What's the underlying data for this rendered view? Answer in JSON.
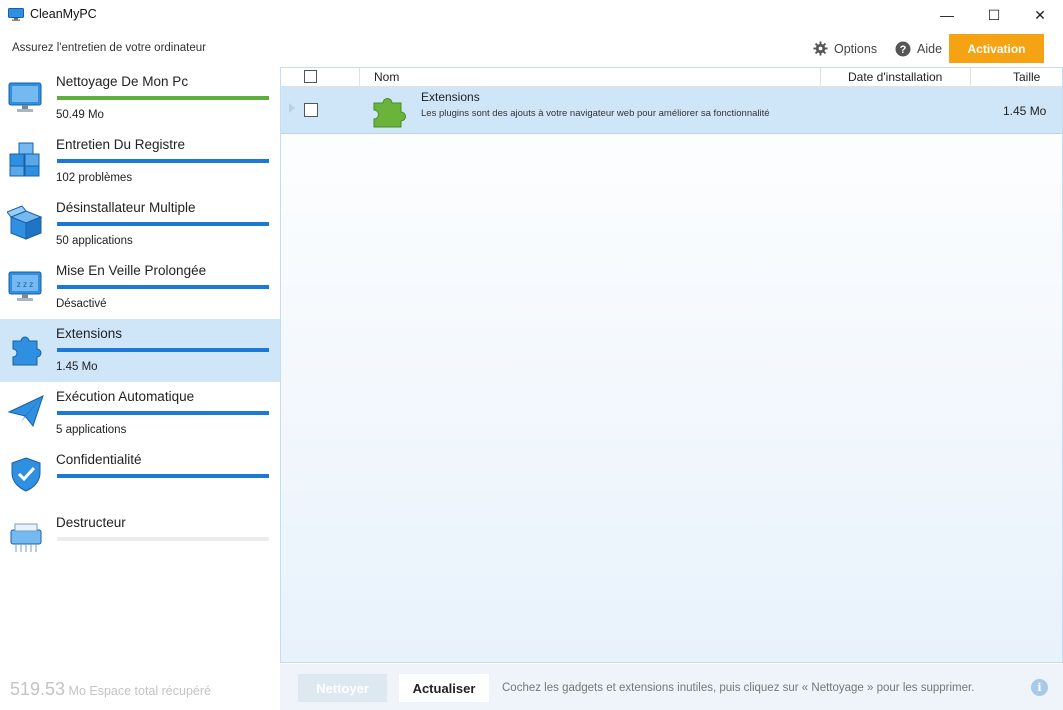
{
  "window": {
    "title": "CleanMyPC",
    "minimize_glyph": "—",
    "maximize_glyph": "☐",
    "close_glyph": "✕"
  },
  "header": {
    "subtitle": "Assurez l'entretien de votre ordinateur",
    "options_label": "Options",
    "help_label": "Aide",
    "activation_label": "Activation",
    "activation_color": "#f5a313"
  },
  "sidebar": {
    "items": [
      {
        "label": "Nettoyage De Mon Pc",
        "sub": "50.49 Mo",
        "icon": "monitor-icon",
        "bar_color": "green",
        "bar_fraction": 1.0
      },
      {
        "label": "Entretien Du Registre",
        "sub": "102 problèmes",
        "icon": "registry-cubes-icon",
        "bar_color": "blue",
        "bar_fraction": 1.0
      },
      {
        "label": "Désinstallateur Multiple",
        "sub": "50 applications",
        "icon": "box-icon",
        "bar_color": "blue",
        "bar_fraction": 1.0
      },
      {
        "label": "Mise En Veille Prolongée",
        "sub": "Désactivé",
        "icon": "sleep-monitor-icon",
        "bar_color": "blue",
        "bar_fraction": 1.0
      },
      {
        "label": "Extensions",
        "sub": "1.45 Mo",
        "icon": "puzzle-icon",
        "bar_color": "blue",
        "bar_fraction": 1.0,
        "active": true
      },
      {
        "label": "Exécution Automatique",
        "sub": "5 applications",
        "icon": "paper-plane-icon",
        "bar_color": "blue",
        "bar_fraction": 1.0
      },
      {
        "label": "Confidentialité",
        "sub": "",
        "icon": "shield-icon",
        "bar_color": "blue",
        "bar_fraction": 1.0
      },
      {
        "label": "Destructeur",
        "sub": "",
        "icon": "shredder-icon",
        "bar_color": "grey",
        "bar_fraction": 0.0
      }
    ],
    "total_value": "519.53",
    "total_label": " Mo Espace total récupéré"
  },
  "table": {
    "columns": {
      "name": "Nom",
      "date": "Date d'installation",
      "size": "Taille"
    },
    "rows": [
      {
        "title": "Extensions",
        "description": "Les plugins sont des ajouts à votre navigateur web pour améliorer sa fonctionnalité",
        "size": "1.45 Mo",
        "icon": "green-puzzle-icon"
      }
    ]
  },
  "footer": {
    "clean_label": "Nettoyer",
    "refresh_label": "Actualiser",
    "hint": "Cochez les gadgets et extensions inutiles, puis cliquez sur « Nettoyage » pour les supprimer.",
    "info_glyph": "i"
  },
  "colors": {
    "accent_blue": "#1c7ad6",
    "progress_green": "#5dae3b",
    "selection": "#cfe6f9"
  }
}
